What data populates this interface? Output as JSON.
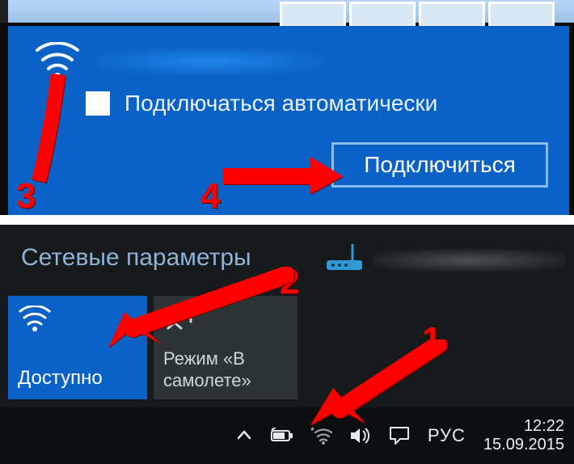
{
  "wifi_panel": {
    "auto_connect_label": "Подключаться автоматически",
    "connect_button": "Подключиться"
  },
  "settings": {
    "title": "Сетевые параметры",
    "wifi_tile_label": "Доступно",
    "airplane_tile_label": "Режим «В самолете»"
  },
  "taskbar": {
    "language": "РУС",
    "time": "12:22",
    "date": "15.09.2015"
  },
  "annotations": {
    "n1": "1",
    "n2": "2",
    "n3": "3",
    "n4": "4"
  }
}
